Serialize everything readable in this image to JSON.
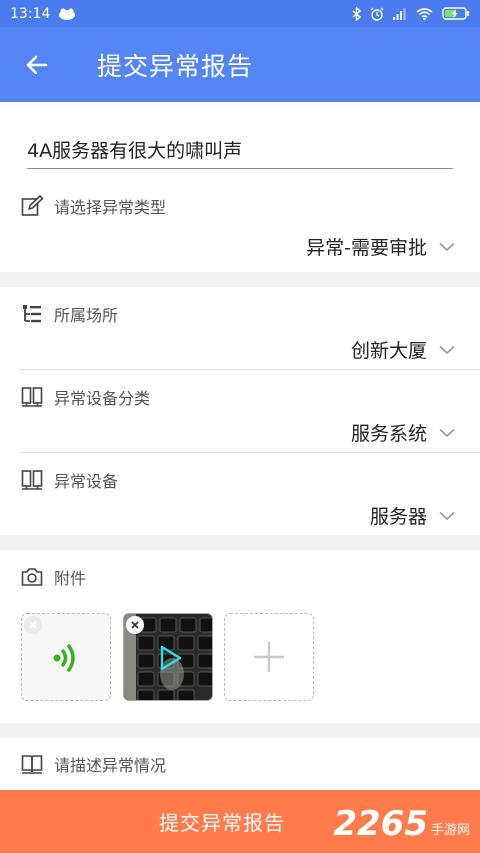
{
  "status_bar": {
    "time": "13:14"
  },
  "app_bar": {
    "title": "提交异常报告"
  },
  "form": {
    "subject": "4A服务器有很大的啸叫声",
    "type_label": "请选择异常类型",
    "type_value": "异常-需要审批",
    "location_label": "所属场所",
    "location_value": "创新大厦",
    "category_label": "异常设备分类",
    "category_value": "服务系统",
    "device_label": "异常设备",
    "device_value": "服务器",
    "attachments_label": "附件",
    "description_label": "请描述异常情况"
  },
  "submit_label": "提交异常报告",
  "watermark": {
    "number": "2265",
    "site": "手游网"
  },
  "colors": {
    "primary": "#5585f5",
    "accent": "#ff7b4b",
    "audio_green": "#3cae28",
    "play_cyan": "#2ee0e6"
  }
}
